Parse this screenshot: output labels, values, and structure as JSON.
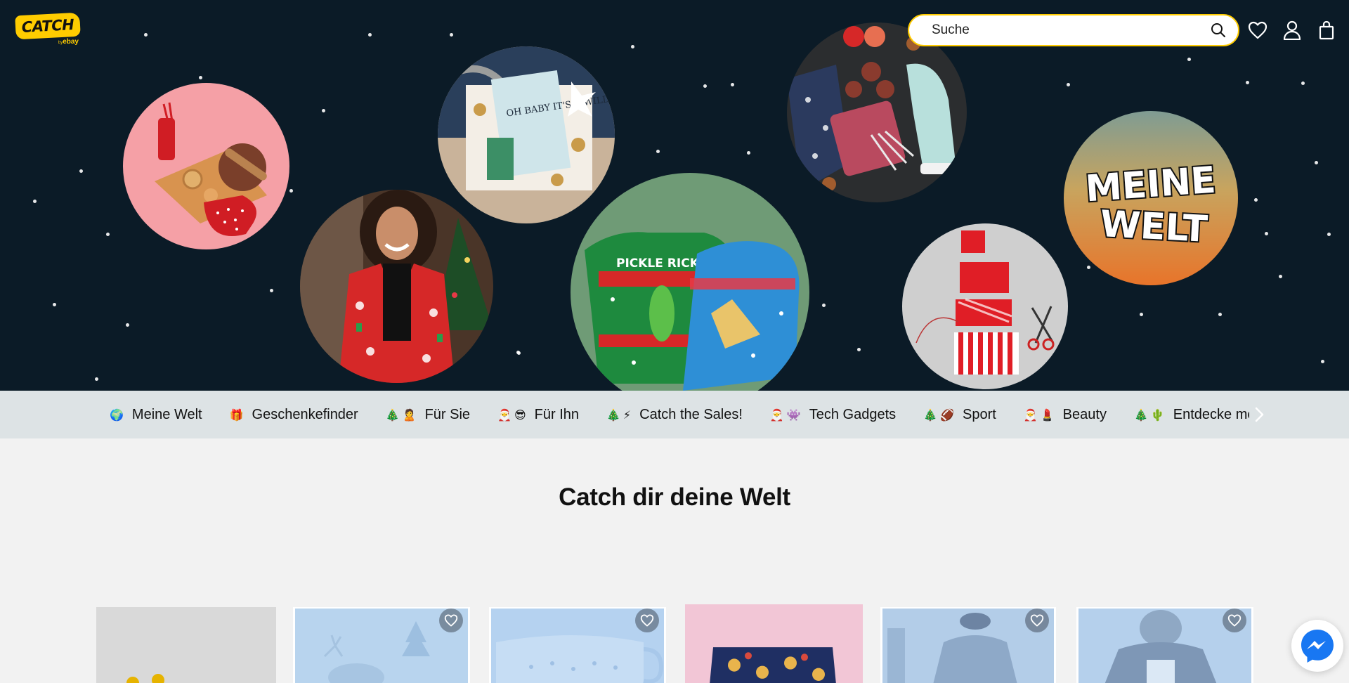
{
  "header": {
    "logo": {
      "text": "CATCH",
      "sub_by": "by",
      "sub_brand": "ebay"
    },
    "search": {
      "placeholder": "Suche",
      "value": ""
    },
    "icons": [
      "search-icon",
      "heart-icon",
      "user-icon",
      "bag-icon"
    ]
  },
  "hero": {
    "bubbles": [
      "baking-set",
      "christmas-suit",
      "travel-gift-box",
      "ugly-christmas-sweaters",
      "cozy-gift-flatlay",
      "wrapped-gifts-stack",
      "meine-welt-badge"
    ],
    "meine_welt_line1": "MEINE",
    "meine_welt_line2": "WELT",
    "book_text": "OH BABY IT'S A WILD WORLD",
    "sweater_text": "PICKLE RICK"
  },
  "categories": [
    {
      "emoji": "🌍",
      "label": "Meine Welt"
    },
    {
      "emoji": "🎁",
      "label": "Geschenkefinder"
    },
    {
      "emoji": "🎄🙎",
      "label": "Für Sie"
    },
    {
      "emoji": "🎅😎",
      "label": "Für Ihn"
    },
    {
      "emoji": "🎄⚡",
      "label": "Catch the Sales!"
    },
    {
      "emoji": "🎅👾",
      "label": "Tech Gadgets"
    },
    {
      "emoji": "🎄🏈",
      "label": "Sport"
    },
    {
      "emoji": "🎅💄",
      "label": "Beauty"
    },
    {
      "emoji": "🎄🌵",
      "label": "Entdecke mehr"
    }
  ],
  "main": {
    "title": "Catch dir deine Welt"
  },
  "colors": {
    "hero_bg": "#0b1b27",
    "brand_yellow": "#ffcc00",
    "category_bar": "#dde3e5",
    "page_bg": "#f2f2f2",
    "messenger_blue": "#1877f2"
  }
}
